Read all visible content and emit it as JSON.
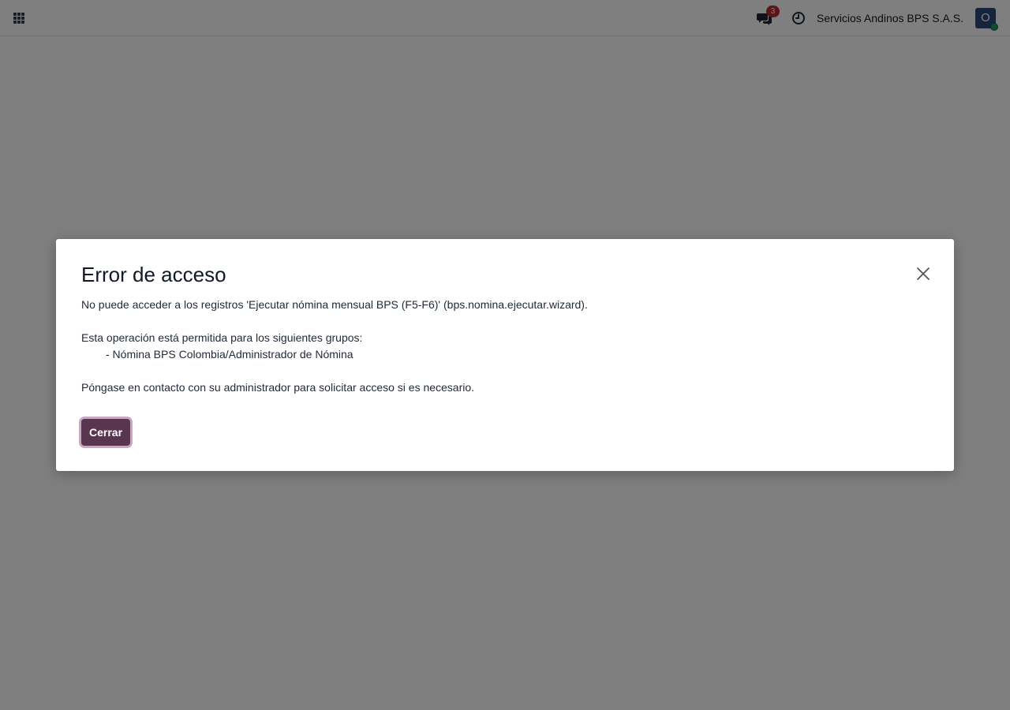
{
  "topbar": {
    "apps_icon": "grid-icon",
    "messages_icon": "chat-icon",
    "messages_badge": "3",
    "activity_icon": "clock-icon",
    "company_name": "Servicios Andinos BPS S.A.S.",
    "avatar_initial": "O"
  },
  "dialog": {
    "title": "Error de acceso",
    "message_line1": "No puede acceder a los registros 'Ejecutar nómina mensual BPS (F5-F6)' (bps.nomina.ejecutar.wizard).",
    "message_line2": "Esta operación está permitida para los siguientes grupos:",
    "group_item": "- Nómina BPS Colombia/Administrador de Nómina",
    "message_line3": "Póngase en contacto con su administrador para solicitar acceso si es necesario.",
    "close_button_label": "Cerrar",
    "close_icon": "close-icon"
  },
  "colors": {
    "primary_button": "#5a3550",
    "badge": "#c1272d",
    "avatar": "#2b4a7a",
    "presence": "#16a34a"
  }
}
